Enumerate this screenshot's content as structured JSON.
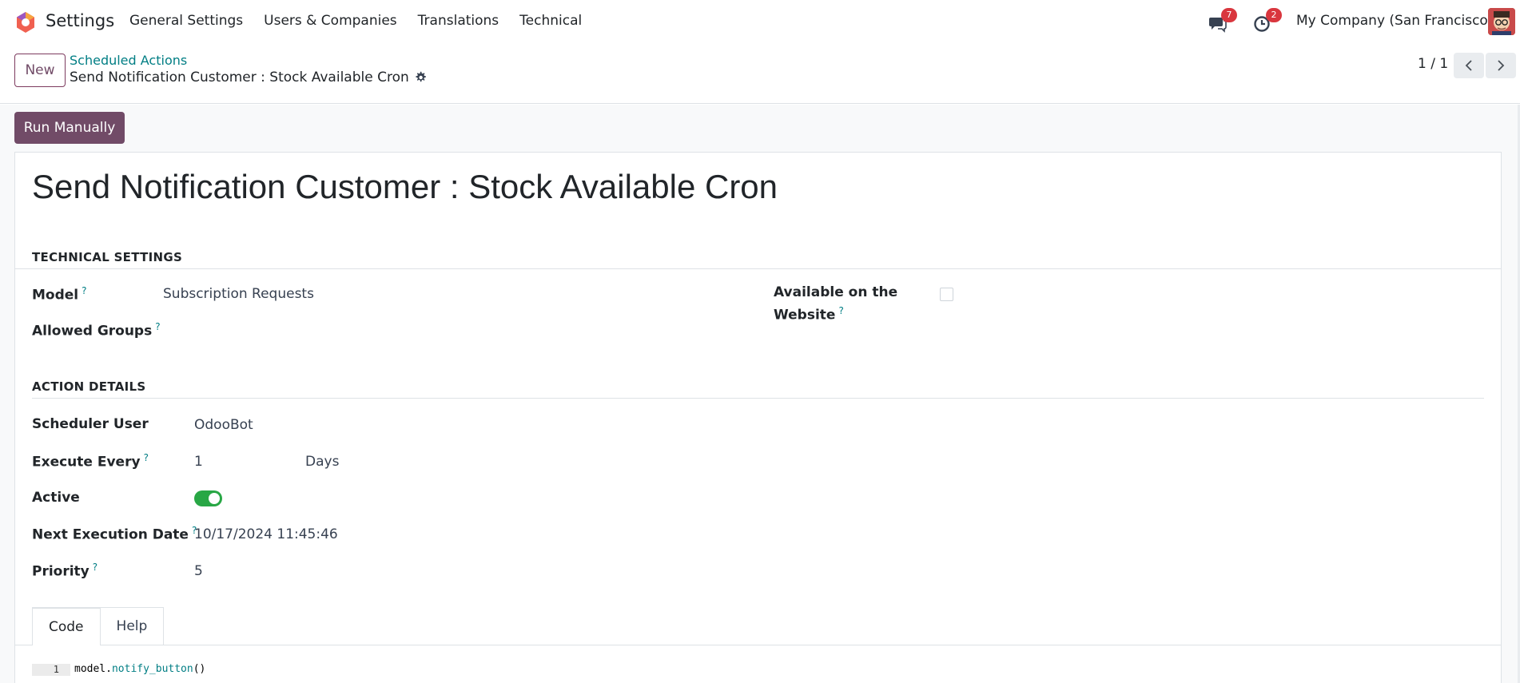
{
  "navbar": {
    "app_name": "Settings",
    "menu": [
      "General Settings",
      "Users & Companies",
      "Translations",
      "Technical"
    ],
    "chat_count": "7",
    "activity_count": "2",
    "company": "My Company (San Francisco)"
  },
  "control_panel": {
    "new_label": "New",
    "breadcrumb_parent": "Scheduled Actions",
    "breadcrumb_current": "Send Notification Customer : Stock Available Cron",
    "pager": "1 / 1"
  },
  "actions": {
    "run_manually": "Run Manually"
  },
  "form": {
    "title": "Send Notification Customer : Stock Available Cron",
    "technical_settings": {
      "heading": "TECHNICAL SETTINGS",
      "model_label": "Model",
      "model_value": "Subscription Requests",
      "allowed_groups_label": "Allowed Groups",
      "website_label_1": "Available on the",
      "website_label_2": "Website",
      "website_checked": false
    },
    "action_details": {
      "heading": "ACTION DETAILS",
      "scheduler_user_label": "Scheduler User",
      "scheduler_user_value": "OdooBot",
      "execute_every_label": "Execute Every",
      "execute_every_value": "1",
      "execute_every_unit": "Days",
      "active_label": "Active",
      "active": true,
      "next_exec_label": "Next Execution Date",
      "next_exec_value": "10/17/2024 11:45:46",
      "priority_label": "Priority",
      "priority_value": "5"
    },
    "help_mark": "?",
    "tabs": [
      "Code",
      "Help"
    ],
    "code": {
      "line_number": "1",
      "object": "model",
      "dot": ".",
      "method": "notify_button",
      "parens": "()"
    }
  },
  "colors": {
    "primary": "#714b67",
    "link": "#017e84",
    "badge": "#d9363e",
    "toggle_on": "#28a745"
  }
}
